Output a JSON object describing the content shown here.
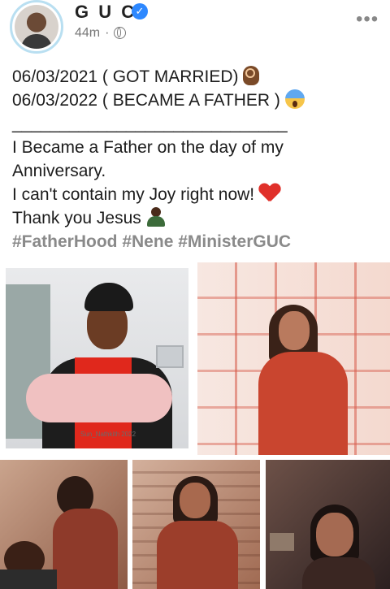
{
  "header": {
    "name": "G U C",
    "time": "44m",
    "dot": "·"
  },
  "post": {
    "lines": [
      "06/03/2021 ( GOT MARRIED)",
      "06/03/2022 ( BECAME A FATHER )",
      "_____________________________",
      "I Became a Father on the day of my",
      "Anniversary.",
      "I can't contain my Joy right now!",
      "Thank you Jesus"
    ],
    "hashtags": "#FatherHood #Nene #MinisterGUC"
  },
  "photo_1": {
    "watermark": "Sun_Nathkith 2022"
  }
}
